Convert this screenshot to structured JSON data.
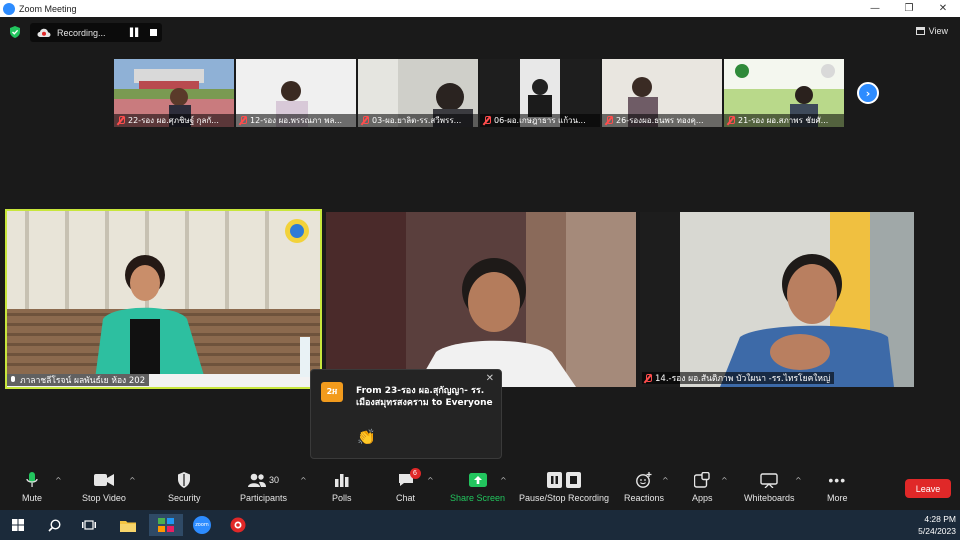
{
  "window": {
    "title": "Zoom Meeting",
    "controls": [
      "—",
      "❐",
      "✕"
    ]
  },
  "topbar": {
    "recording_label": "Recording...",
    "view_label": "View"
  },
  "thumbnails": [
    {
      "name": "22-รอง ผอ.ศุภชิษฐ์ กุลกั..."
    },
    {
      "name": "12-รอง ผอ.พรรณภา พล..."
    },
    {
      "name": "03-ผอ.ยาลิต-รร.สวีพรร..."
    },
    {
      "name": "06-ผอ.เกษฎาธาร แก้วน..."
    },
    {
      "name": "26-รองผอ.ธนพร ทองคุ..."
    },
    {
      "name": "21-รอง ผอ.สภาพร ชัยศั..."
    }
  ],
  "gallery": [
    {
      "name": "ภาลาชลีโรจน์ ผลพันธ์เย ห้อง 202"
    },
    {
      "name": ""
    },
    {
      "name": "14.-รอง ผอ.สันติภาพ บัวใผนา -รร.ไทรโยคใหญ่"
    }
  ],
  "chat_popup": {
    "avatar": "2អ",
    "from_line1": "From 23-รอง ผอ.สุกัญญา- รร.",
    "from_line2": "เมืองสมุทรสงคราม to Everyone",
    "message": "👏",
    "close": "✕"
  },
  "toolbar": {
    "mute": "Mute",
    "stop_video": "Stop Video",
    "security": "Security",
    "participants": "Participants",
    "participants_count": "30",
    "polls": "Polls",
    "chat": "Chat",
    "chat_badge": "6",
    "share_screen": "Share Screen",
    "recording": "Pause/Stop Recording",
    "reactions": "Reactions",
    "apps": "Apps",
    "whiteboards": "Whiteboards",
    "more": "More",
    "leave": "Leave"
  },
  "taskbar": {
    "time": "4:28 PM",
    "date": "5/24/2023",
    "zoom_icon_text": "zoom"
  },
  "colors": {
    "accent": "#2d8cff",
    "leave": "#e02828",
    "active_speaker": "#c8e63c",
    "share_green": "#22c55e"
  }
}
